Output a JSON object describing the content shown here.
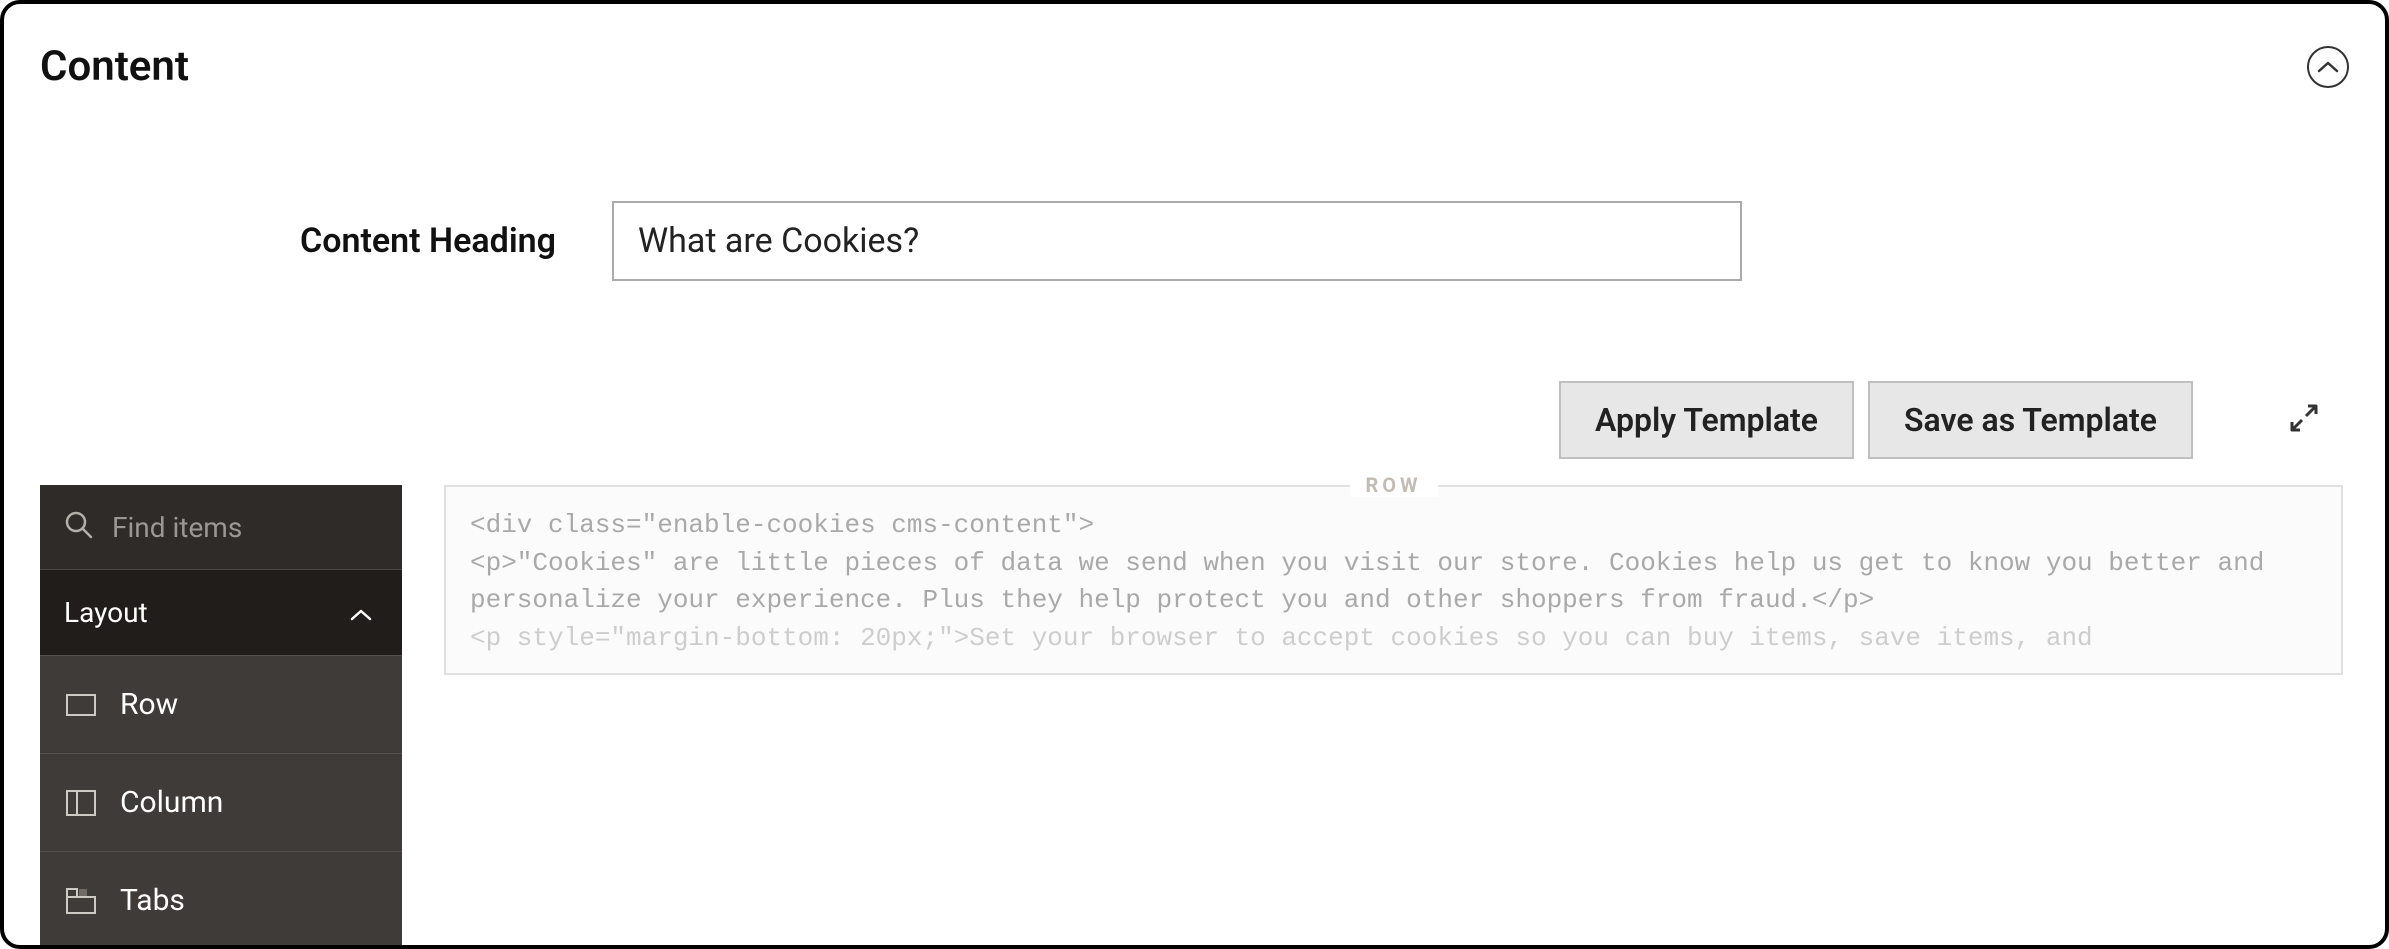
{
  "section": {
    "title": "Content"
  },
  "form": {
    "heading_label": "Content Heading",
    "heading_value": "What are Cookies?"
  },
  "toolbar": {
    "apply_template": "Apply Template",
    "save_template": "Save as Template"
  },
  "sidebar": {
    "search_placeholder": "Find items",
    "group_label": "Layout",
    "items": [
      {
        "label": "Row"
      },
      {
        "label": "Column"
      },
      {
        "label": "Tabs"
      }
    ]
  },
  "canvas": {
    "frame_label": "ROW",
    "code_line1": "<div class=\"enable-cookies cms-content\">",
    "code_line2": "<p>\"Cookies\" are little pieces of data we send when you visit our store. Cookies help us get to know you better and personalize your experience. Plus they help protect you and other shoppers from fraud.</p>",
    "code_line3": "<p style=\"margin-bottom: 20px;\">Set your browser to accept cookies so you can buy items, save items, and"
  }
}
